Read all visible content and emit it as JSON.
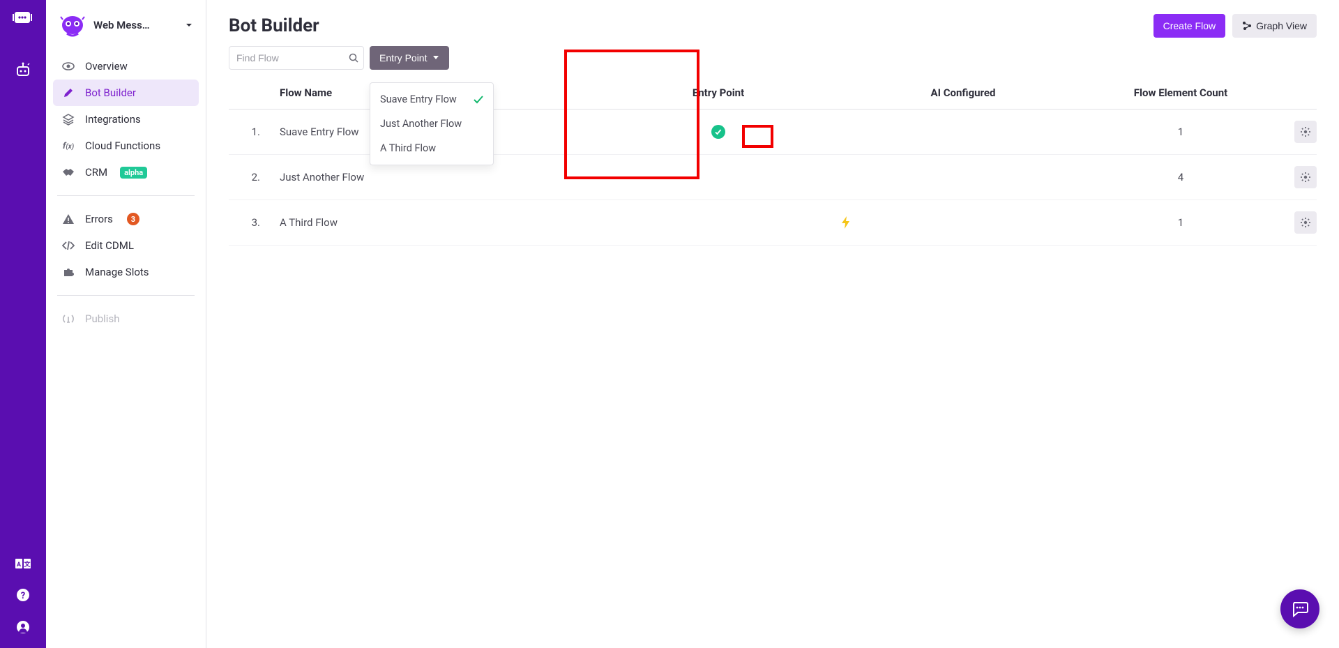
{
  "rail": {
    "icons": [
      "chat-bubble-icon",
      "robot-icon",
      "translate-icon",
      "help-icon",
      "user-icon"
    ]
  },
  "sidebar": {
    "bot_name": "Web Mess…",
    "nav1": [
      {
        "icon": "eye",
        "label": "Overview",
        "active": false
      },
      {
        "icon": "pencil",
        "label": "Bot Builder",
        "active": true
      },
      {
        "icon": "layers",
        "label": "Integrations",
        "active": false
      },
      {
        "icon": "fx",
        "label": "Cloud Functions",
        "active": false
      },
      {
        "icon": "handshake",
        "label": "CRM",
        "badge": "alpha",
        "active": false
      }
    ],
    "nav2": [
      {
        "icon": "warning",
        "label": "Errors",
        "count": "3"
      },
      {
        "icon": "code",
        "label": "Edit CDML"
      },
      {
        "icon": "puzzle",
        "label": "Manage Slots"
      }
    ],
    "nav3": [
      {
        "icon": "broadcast",
        "label": "Publish",
        "disabled": true
      }
    ]
  },
  "page": {
    "title": "Bot Builder",
    "create_flow": "Create Flow",
    "graph_view": "Graph View",
    "search_placeholder": "Find Flow",
    "entry_point_btn": "Entry Point",
    "dropdown": [
      {
        "label": "Suave Entry Flow",
        "selected": true
      },
      {
        "label": "Just Another Flow",
        "selected": false
      },
      {
        "label": "A Third Flow",
        "selected": false
      }
    ],
    "columns": {
      "name": "Flow Name",
      "entry": "Entry Point",
      "ai": "AI Configured",
      "count": "Flow Element Count"
    },
    "rows": [
      {
        "idx": "1.",
        "name": "Suave Entry Flow",
        "entry": true,
        "ai": false,
        "count": "1"
      },
      {
        "idx": "2.",
        "name": "Just Another Flow",
        "entry": false,
        "ai": false,
        "count": "4"
      },
      {
        "idx": "3.",
        "name": "A Third Flow",
        "entry": false,
        "ai": true,
        "count": "1"
      }
    ]
  }
}
